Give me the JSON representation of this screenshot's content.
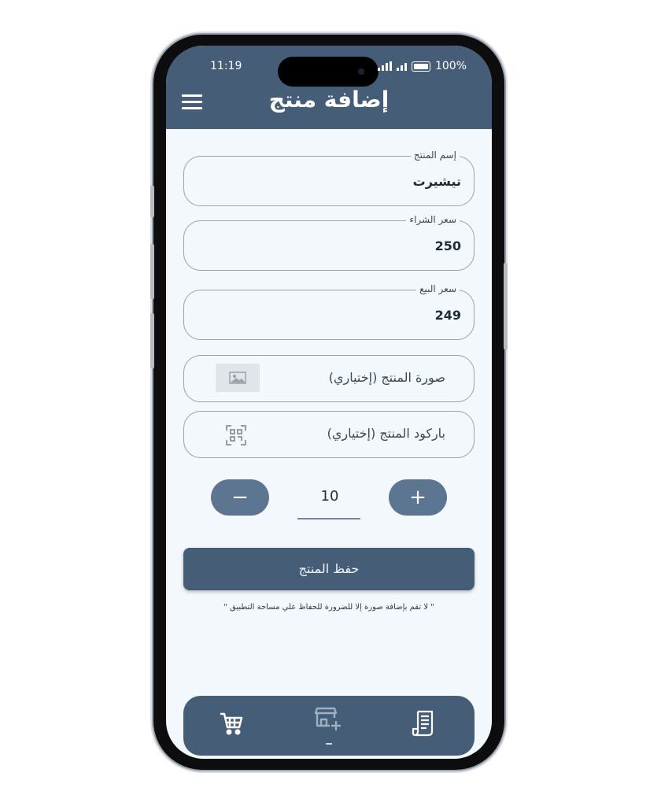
{
  "status_bar": {
    "time": "11:19",
    "battery": "100%"
  },
  "header": {
    "title": "إضافة منتج"
  },
  "form": {
    "product_name": {
      "label": "إسم المنتج",
      "value": "تيشيرت"
    },
    "purchase_price": {
      "label": "سعر الشراء",
      "value": "250"
    },
    "sale_price": {
      "label": "سعر البيع",
      "value": "249"
    },
    "image_option": {
      "label": "صورة المنتج (إختياري)"
    },
    "barcode_option": {
      "label": "باركود المنتج (إختياري)"
    }
  },
  "quantity": {
    "minus": "−",
    "value": "10",
    "plus": "+"
  },
  "save_button": {
    "label": "حفظ المنتج"
  },
  "note": "\" لا تقم بإضافة صورة إلا للضرورة للحفاظ علي مساحة التطبيق \"",
  "bottom_nav": {
    "items": [
      "cart-icon",
      "add-store-icon",
      "receipt-icon"
    ]
  },
  "colors": {
    "primary": "#465d77",
    "stepper": "#5c7591",
    "background": "#f3f8fc"
  }
}
